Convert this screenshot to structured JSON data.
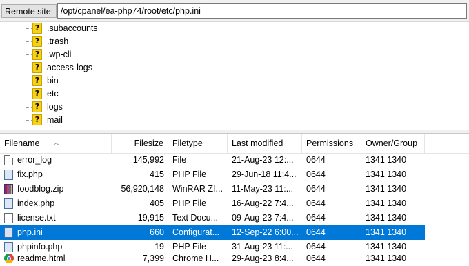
{
  "remote_site": {
    "label": "Remote site:",
    "path": "/opt/cpanel/ea-php74/root/etc/php.ini"
  },
  "tree": {
    "items": [
      {
        "label": ".subaccounts",
        "icon": "question-folder-icon"
      },
      {
        "label": ".trash",
        "icon": "question-folder-icon"
      },
      {
        "label": ".wp-cli",
        "icon": "question-folder-icon"
      },
      {
        "label": "access-logs",
        "icon": "question-folder-icon"
      },
      {
        "label": "bin",
        "icon": "question-folder-icon"
      },
      {
        "label": "etc",
        "icon": "question-folder-icon"
      },
      {
        "label": "logs",
        "icon": "question-folder-icon"
      },
      {
        "label": "mail",
        "icon": "question-folder-icon"
      }
    ]
  },
  "filelist": {
    "columns": {
      "filename": "Filename",
      "filesize": "Filesize",
      "filetype": "Filetype",
      "last_modified": "Last modified",
      "permissions": "Permissions",
      "owner_group": "Owner/Group"
    },
    "selected_color": "#0078d7",
    "rows": [
      {
        "name": "error_log",
        "size": "145,992",
        "type": "File",
        "modified": "21-Aug-23 12:...",
        "perm": "0644",
        "owner": "1341 1340",
        "icon": "doc"
      },
      {
        "name": "fix.php",
        "size": "415",
        "type": "PHP File",
        "modified": "29-Jun-18 11:4...",
        "perm": "0644",
        "owner": "1341 1340",
        "icon": "php"
      },
      {
        "name": "foodblog.zip",
        "size": "56,920,148",
        "type": "WinRAR ZI...",
        "modified": "11-May-23 11:...",
        "perm": "0644",
        "owner": "1341 1340",
        "icon": "zip"
      },
      {
        "name": "index.php",
        "size": "405",
        "type": "PHP File",
        "modified": "16-Aug-22 7:4...",
        "perm": "0644",
        "owner": "1341 1340",
        "icon": "php"
      },
      {
        "name": "license.txt",
        "size": "19,915",
        "type": "Text Docu...",
        "modified": "09-Aug-23 7:4...",
        "perm": "0644",
        "owner": "1341 1340",
        "icon": "txt"
      },
      {
        "name": "php.ini",
        "size": "660",
        "type": "Configurat...",
        "modified": "12-Sep-22 6:00...",
        "perm": "0644",
        "owner": "1341 1340",
        "icon": "ini",
        "selected": true
      },
      {
        "name": "phpinfo.php",
        "size": "19",
        "type": "PHP File",
        "modified": "31-Aug-23 11:...",
        "perm": "0644",
        "owner": "1341 1340",
        "icon": "php"
      },
      {
        "name": "readme.html",
        "size": "7,399",
        "type": "Chrome H...",
        "modified": "29-Aug-23 8:4...",
        "perm": "0644",
        "owner": "1341 1340",
        "icon": "chrome"
      }
    ]
  }
}
